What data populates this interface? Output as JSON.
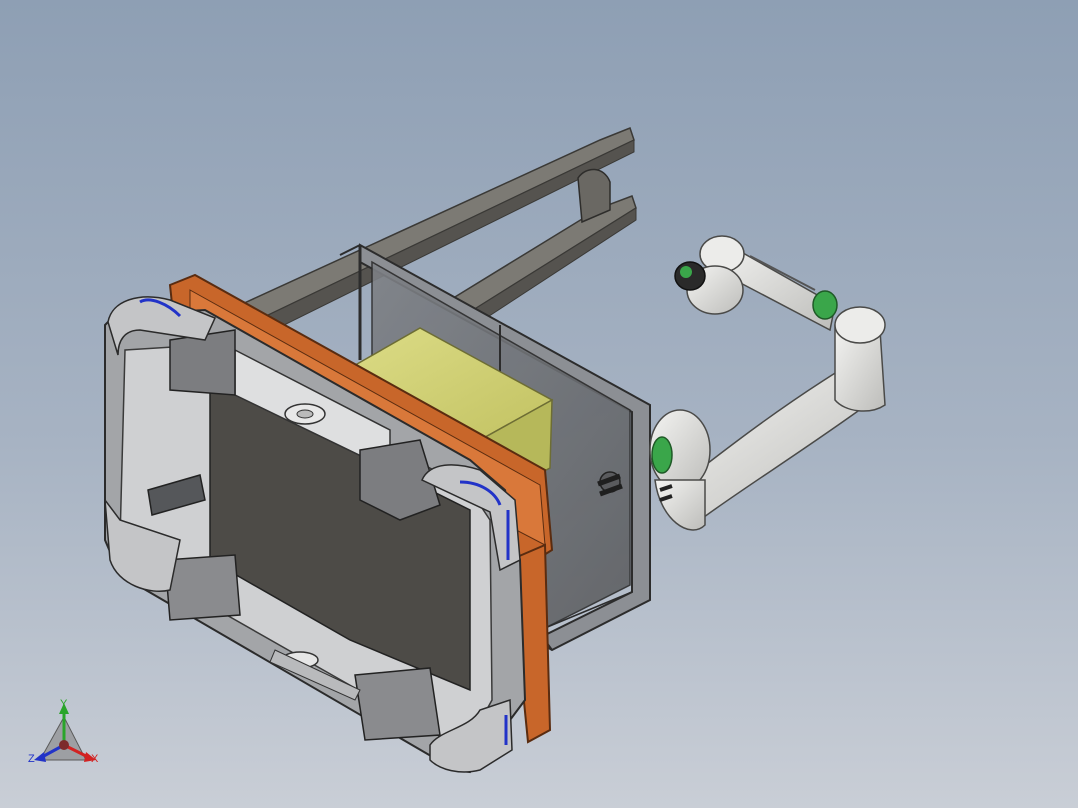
{
  "viewport": {
    "background_top": "#8e9fb4",
    "background_bottom": "#c9ced6"
  },
  "model": {
    "frame_color": "#6f6e69",
    "orange_plate_color": "#c8662a",
    "payload_box_color": "#cfcf72",
    "robot_arm_color": "#e4e4e2",
    "robot_joint_accent_color": "#3aa64a"
  },
  "triad": {
    "x_label": "X",
    "y_label": "Y",
    "z_label": "Z",
    "x_color": "#d22222",
    "y_color": "#2aa52a",
    "z_color": "#2233c8"
  }
}
